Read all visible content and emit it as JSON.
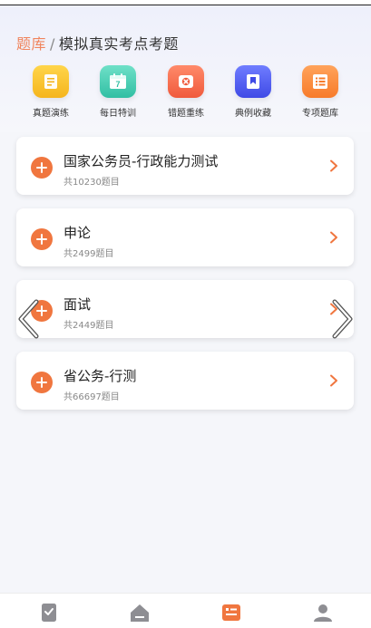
{
  "breadcrumb": {
    "root": "题库",
    "separator": "/",
    "current": "模拟真实考点考题"
  },
  "shortcuts": [
    {
      "label": "真题演练",
      "icon": "document-icon",
      "color_top": "#ffd54a",
      "color_bottom": "#f5b51d"
    },
    {
      "label": "每日特训",
      "icon": "calendar-icon",
      "color_top": "#6fe0c8",
      "color_bottom": "#31bfa3",
      "badge": "7"
    },
    {
      "label": "错题重练",
      "icon": "error-book-icon",
      "color_top": "#ff8a6a",
      "color_bottom": "#f05a3c"
    },
    {
      "label": "典例收藏",
      "icon": "bookmark-icon",
      "color_top": "#6f7dff",
      "color_bottom": "#3f4ae6"
    },
    {
      "label": "专项题库",
      "icon": "list-icon",
      "color_top": "#ffa35b",
      "color_bottom": "#f77b2a"
    }
  ],
  "categories": [
    {
      "title": "国家公务员-行政能力测试",
      "count": "共10230题目"
    },
    {
      "title": "申论",
      "count": "共2499题目"
    },
    {
      "title": "面试",
      "count": "共2449题目"
    },
    {
      "title": "省公务-行测",
      "count": "共66697题目"
    }
  ],
  "tabbar": {
    "items": [
      {
        "icon": "exercise-icon",
        "active": false
      },
      {
        "icon": "home-icon",
        "active": false
      },
      {
        "icon": "question-bank-icon",
        "active": true
      },
      {
        "icon": "profile-icon",
        "active": false
      }
    ],
    "active_color": "#f0763f",
    "inactive_color": "#8e8e93"
  },
  "colors": {
    "accent": "#f0763f",
    "breadcrumb_root": "#f0845d"
  }
}
